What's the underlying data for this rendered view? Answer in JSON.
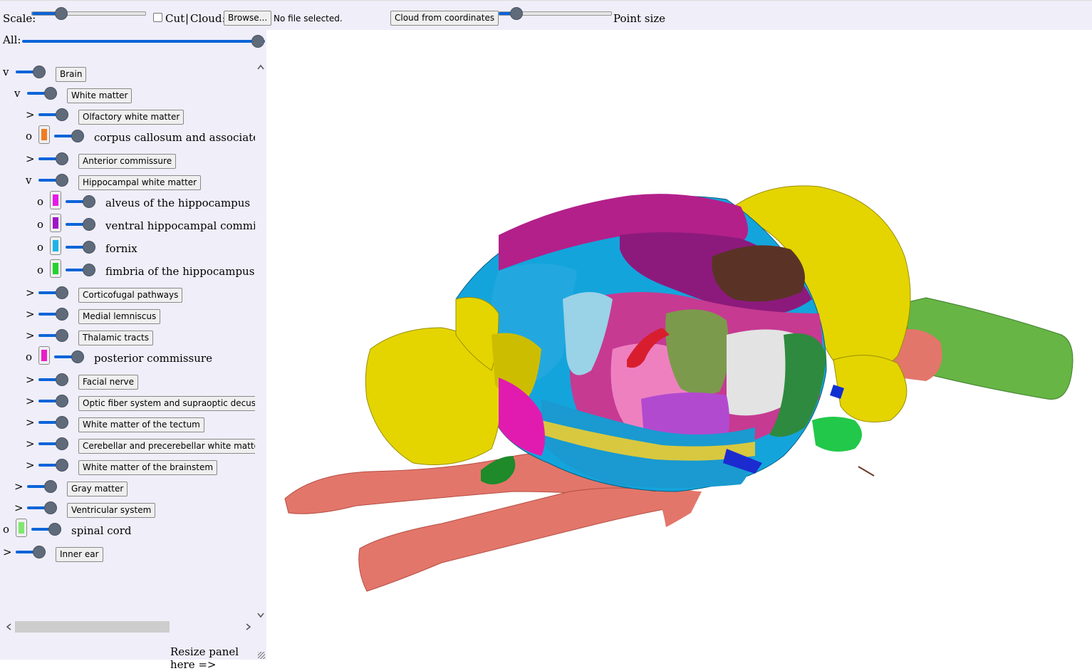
{
  "toolbar": {
    "scale_label": "Scale:",
    "scale_value": 0.27,
    "cut_label": "Cut",
    "separator": "|",
    "cloud_label": "Cloud:",
    "browse_label": "Browse...",
    "file_status": "No file selected.",
    "cloud_coords_label": "Cloud from coordinates",
    "point_size_label": "Point size",
    "point_size_value": 0.17
  },
  "panel": {
    "all_label": "All:",
    "all_value": 1.0,
    "resize_label": "Resize panel here =>",
    "accent_color": "#0a64d8"
  },
  "tree": [
    {
      "twisty": "v",
      "label": "Brain",
      "type": "button"
    },
    {
      "twisty": "v",
      "label": "White matter",
      "type": "button"
    },
    {
      "twisty": ">",
      "label": "Olfactory white matter",
      "type": "button"
    },
    {
      "twisty": "o",
      "label": "corpus callosum and associated subcortical white matter",
      "type": "leaf",
      "color": "#f07c22"
    },
    {
      "twisty": ">",
      "label": "Anterior commissure",
      "type": "button"
    },
    {
      "twisty": "v",
      "label": "Hippocampal white matter",
      "type": "button"
    },
    {
      "twisty": "o",
      "label": "alveus of the hippocampus",
      "type": "leaf",
      "color": "#e61ae6"
    },
    {
      "twisty": "o",
      "label": "ventral hippocampal commissure",
      "type": "leaf",
      "color": "#a014c8"
    },
    {
      "twisty": "o",
      "label": "fornix",
      "type": "leaf",
      "color": "#1eb4e6"
    },
    {
      "twisty": "o",
      "label": "fimbria of the hippocampus",
      "type": "leaf",
      "color": "#22d22c"
    },
    {
      "twisty": ">",
      "label": "Corticofugal pathways",
      "type": "button"
    },
    {
      "twisty": ">",
      "label": "Medial lemniscus",
      "type": "button"
    },
    {
      "twisty": ">",
      "label": "Thalamic tracts",
      "type": "button"
    },
    {
      "twisty": "o",
      "label": "posterior commissure",
      "type": "leaf",
      "color": "#e81ec8"
    },
    {
      "twisty": ">",
      "label": "Facial nerve",
      "type": "button"
    },
    {
      "twisty": ">",
      "label": "Optic fiber system and supraoptic decussation",
      "type": "button"
    },
    {
      "twisty": ">",
      "label": "White matter of the tectum",
      "type": "button"
    },
    {
      "twisty": ">",
      "label": "Cerebellar and precerebellar white matter",
      "type": "button"
    },
    {
      "twisty": ">",
      "label": "White matter of the brainstem",
      "type": "button"
    },
    {
      "twisty": ">",
      "label": "Gray matter",
      "type": "button"
    },
    {
      "twisty": ">",
      "label": "Ventricular system",
      "type": "button"
    },
    {
      "twisty": "o",
      "label": "spinal cord",
      "type": "leaf",
      "color": "#7ee86e"
    },
    {
      "twisty": ">",
      "label": "Inner ear",
      "type": "button"
    }
  ]
}
